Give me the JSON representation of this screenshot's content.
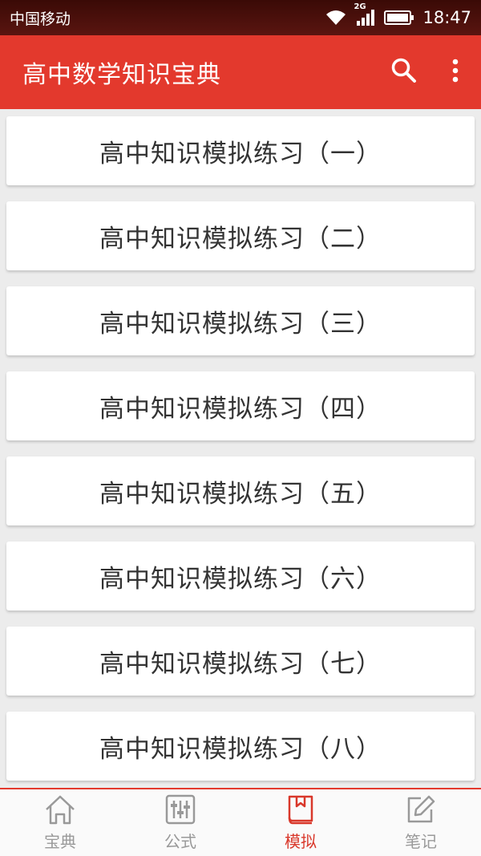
{
  "status_bar": {
    "carrier": "中国移动",
    "network": "2G",
    "time": "18:47",
    "icons": [
      "wifi-icon",
      "signal-icon",
      "battery-icon"
    ]
  },
  "app_bar": {
    "title": "高中数学知识宝典",
    "icons": [
      "search-icon",
      "more-vert-icon"
    ],
    "color": "#e3392d"
  },
  "list": {
    "items": [
      "高中知识模拟练习（一）",
      "高中知识模拟练习（二）",
      "高中知识模拟练习（三）",
      "高中知识模拟练习（四）",
      "高中知识模拟练习（五）",
      "高中知识模拟练习（六）",
      "高中知识模拟练习（七）",
      "高中知识模拟练习（八）"
    ]
  },
  "bottom_nav": {
    "items": [
      {
        "label": "宝典",
        "icon": "home-icon",
        "active": false
      },
      {
        "label": "公式",
        "icon": "sliders-icon",
        "active": false
      },
      {
        "label": "模拟",
        "icon": "book-icon",
        "active": true
      },
      {
        "label": "笔记",
        "icon": "edit-icon",
        "active": false
      }
    ],
    "active_color": "#d9382b",
    "inactive_color": "#999999"
  }
}
